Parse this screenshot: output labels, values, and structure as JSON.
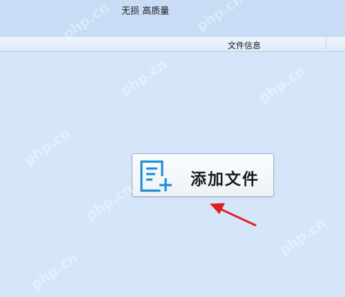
{
  "header": {
    "quality_label": "无损 高质量"
  },
  "file_list": {
    "column_header": "文件信息"
  },
  "add_file_button": {
    "label": "添加文件",
    "icon": "add-file-icon"
  },
  "annotation": {
    "arrow_color": "#e02020"
  },
  "watermark": {
    "text": "php.cn"
  },
  "colors": {
    "background": "#d6e6fa",
    "banner": "#c9dcf6",
    "icon_blue": "#1f8ed6"
  }
}
